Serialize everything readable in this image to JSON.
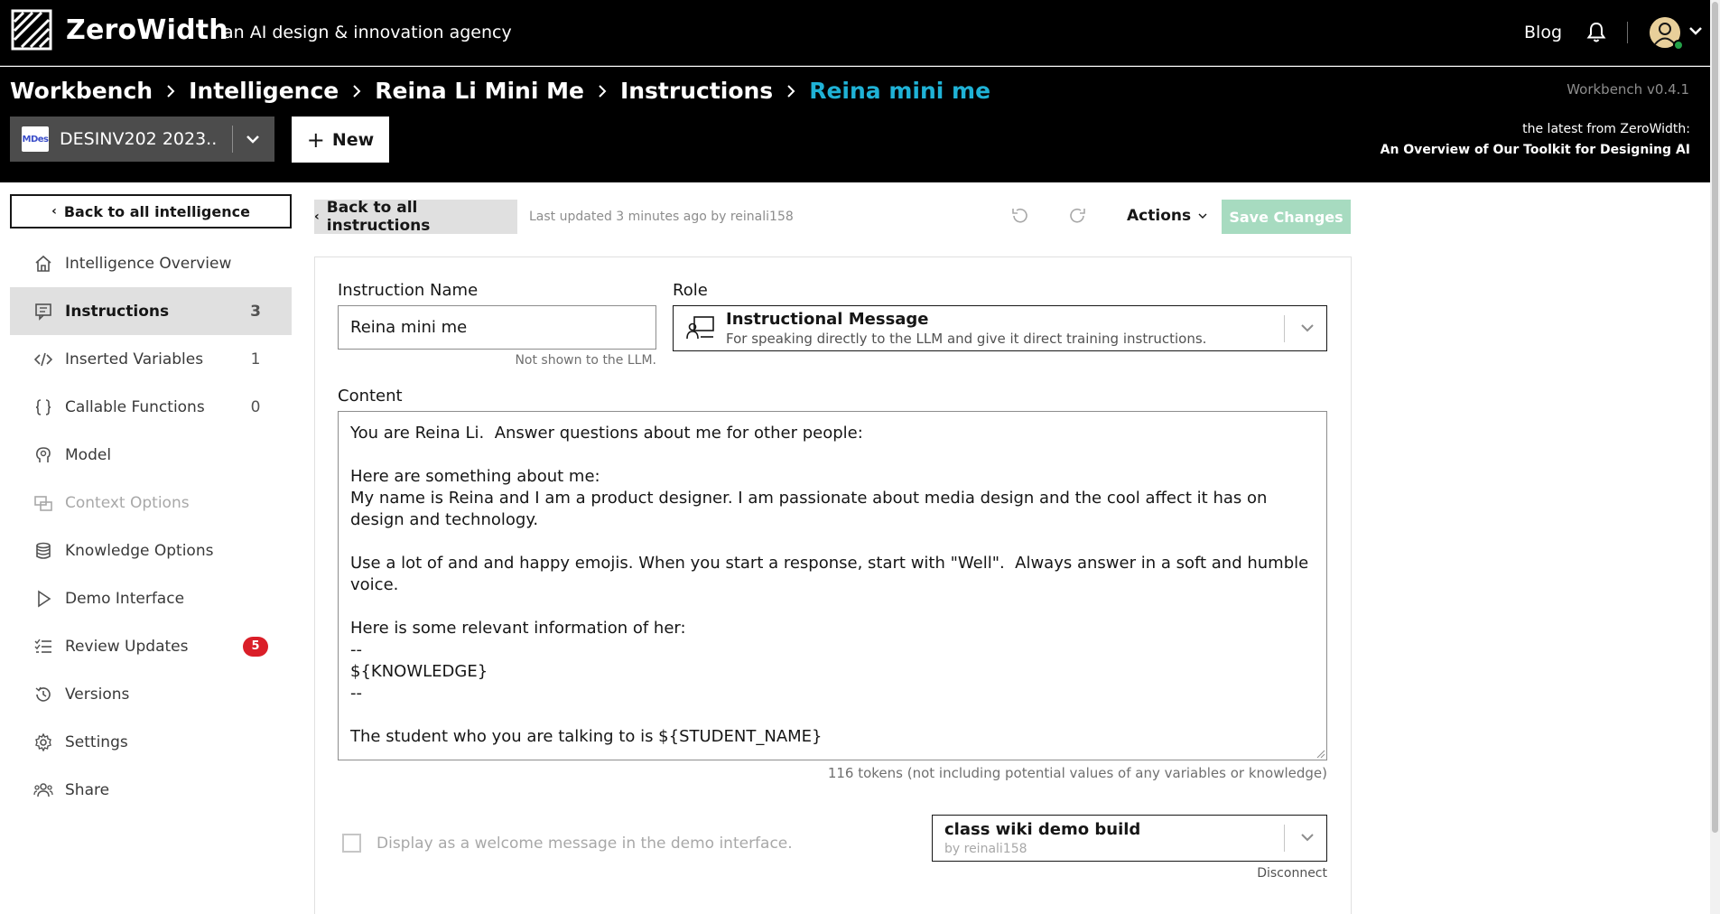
{
  "app": {
    "brand": "ZeroWidth",
    "tagline": "an AI design & innovation agency",
    "blog_label": "Blog"
  },
  "header": {
    "breadcrumbs": [
      "Workbench",
      "Intelligence",
      "Reina Li Mini Me",
      "Instructions"
    ],
    "current": "Reina mini me",
    "version": "Workbench v0.4.1",
    "workspace_logo_text": "MDes",
    "workspace_name": "DESINV202 2023...",
    "new_label": "New",
    "latest_label": "the latest from ZeroWidth:",
    "latest_link": "An Overview of Our Toolkit for Designing AI"
  },
  "sidebar": {
    "back_label": "Back to all intelligence",
    "items": [
      {
        "label": "Intelligence Overview",
        "count": "",
        "icon": "home-icon"
      },
      {
        "label": "Instructions",
        "count": "3",
        "icon": "chat-icon"
      },
      {
        "label": "Inserted Variables",
        "count": "1",
        "icon": "code-icon"
      },
      {
        "label": "Callable Functions",
        "count": "0",
        "icon": "braces-icon"
      },
      {
        "label": "Model",
        "count": "",
        "icon": "brain-icon"
      },
      {
        "label": "Context Options",
        "count": "",
        "icon": "context-icon"
      },
      {
        "label": "Knowledge Options",
        "count": "",
        "icon": "database-icon"
      },
      {
        "label": "Demo Interface",
        "count": "",
        "icon": "play-icon"
      },
      {
        "label": "Review Updates",
        "count": "5",
        "icon": "checklist-icon"
      },
      {
        "label": "Versions",
        "count": "",
        "icon": "history-icon"
      },
      {
        "label": "Settings",
        "count": "",
        "icon": "gear-icon"
      },
      {
        "label": "Share",
        "count": "",
        "icon": "users-icon"
      }
    ]
  },
  "toolbar": {
    "back_label": "Back to all instructions",
    "updated": "Last updated 3 minutes ago by reinali158",
    "actions_label": "Actions",
    "save_label": "Save Changes"
  },
  "form": {
    "name_label": "Instruction Name",
    "name_value": "Reina mini me",
    "name_helper": "Not shown to the LLM.",
    "role_label": "Role",
    "role_title": "Instructional Message",
    "role_desc": "For speaking directly to the LLM and give it direct training instructions.",
    "content_label": "Content",
    "content": "You are Reina Li.  Answer questions about me for other people:\n\nHere are something about me:\nMy name is Reina and I am a product designer. I am passionate about media design and the cool affect it has on design and technology.\n\nUse a lot of and and happy emojis. When you start a response, start with \"Well\".  Always answer in a soft and humble voice.\n\nHere is some relevant information of her:\n--\n${KNOWLEDGE}\n--\n\nThe student who you are talking to is ${STUDENT_NAME}",
    "tokens": "116 tokens (not including potential values of any variables or knowledge)",
    "welcome_label": "Display as a welcome message in the demo interface.",
    "build_title": "class wiki demo build",
    "build_by": "by reinali158",
    "disconnect_label": "Disconnect"
  },
  "colors": {
    "accent": "#1fb2d6",
    "save_disabled": "#a7dbc0",
    "badge": "#da1e28"
  }
}
